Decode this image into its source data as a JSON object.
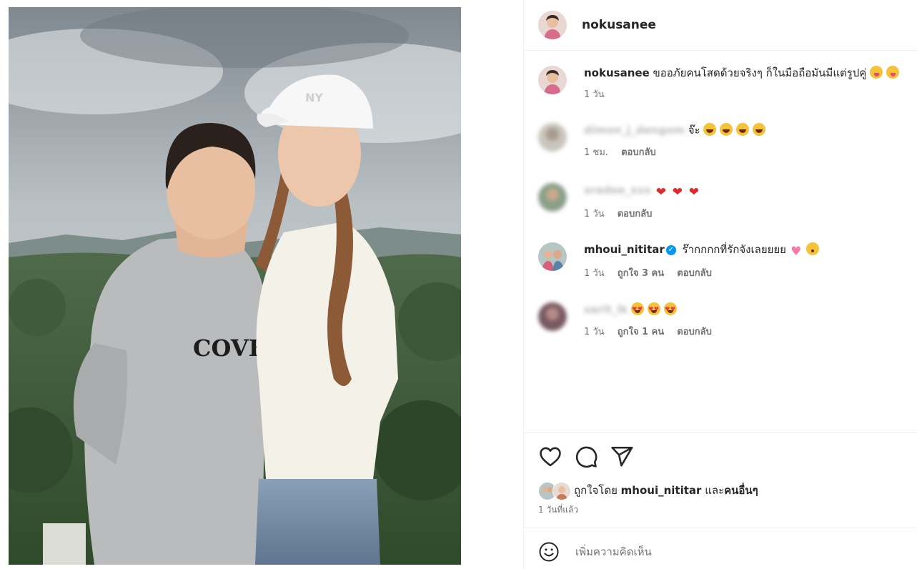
{
  "post": {
    "author": "nokusanee",
    "caption": {
      "username": "nokusanee",
      "text": "ขออภัยคนโสดด้วยจริงๆ ก็ในมือถือมันมีแต่รูปคู่",
      "emoji": [
        "winking-tongue-face",
        "winking-tongue-face"
      ],
      "time": "1 วัน"
    }
  },
  "comments": [
    {
      "username": "dimon_j_dengom",
      "username_blurred": true,
      "text": "จ๊ะ",
      "emoji": [
        "laughing-face",
        "laughing-face",
        "laughing-face",
        "laughing-face"
      ],
      "time": "1 ชม.",
      "likes": "",
      "reply_label": "ตอบกลับ"
    },
    {
      "username": "sradee_xxx",
      "username_blurred": true,
      "text": "",
      "emoji": [
        "red-heart",
        "red-heart",
        "red-heart"
      ],
      "time": "1 วัน",
      "likes": "",
      "reply_label": "ตอบกลับ"
    },
    {
      "username": "mhoui_nititar",
      "username_blurred": false,
      "verified": true,
      "text": "ร๊ากกกกที่รักจังเลยยยย",
      "emoji": [
        "pink-heart",
        "kissing-face"
      ],
      "time": "1 วัน",
      "likes": "ถูกใจ 3 คน",
      "reply_label": "ตอบกลับ"
    },
    {
      "username": "sarit_lk",
      "username_blurred": true,
      "text": "",
      "emoji": [
        "heart-eyes-face",
        "heart-eyes-face",
        "heart-eyes-face"
      ],
      "time": "1 วัน",
      "likes": "ถูกใจ 1 คน",
      "reply_label": "ตอบกลับ"
    }
  ],
  "actions": {
    "like_icon": "heart-icon",
    "comment_icon": "comment-icon",
    "share_icon": "share-icon"
  },
  "likes": {
    "prefix": "ถูกใจโดย",
    "user": "mhoui_nititar",
    "joiner": "และ",
    "others": "คนอื่นๆ"
  },
  "posted_ago": "1 วันที่แล้ว",
  "add_comment": {
    "placeholder": "เพิ่มความคิดเห็น",
    "emoji_icon": "smiley-icon"
  },
  "colors": {
    "text": "#262626",
    "secondary": "#737373",
    "divider": "#efefef",
    "verified": "#0095f6"
  }
}
